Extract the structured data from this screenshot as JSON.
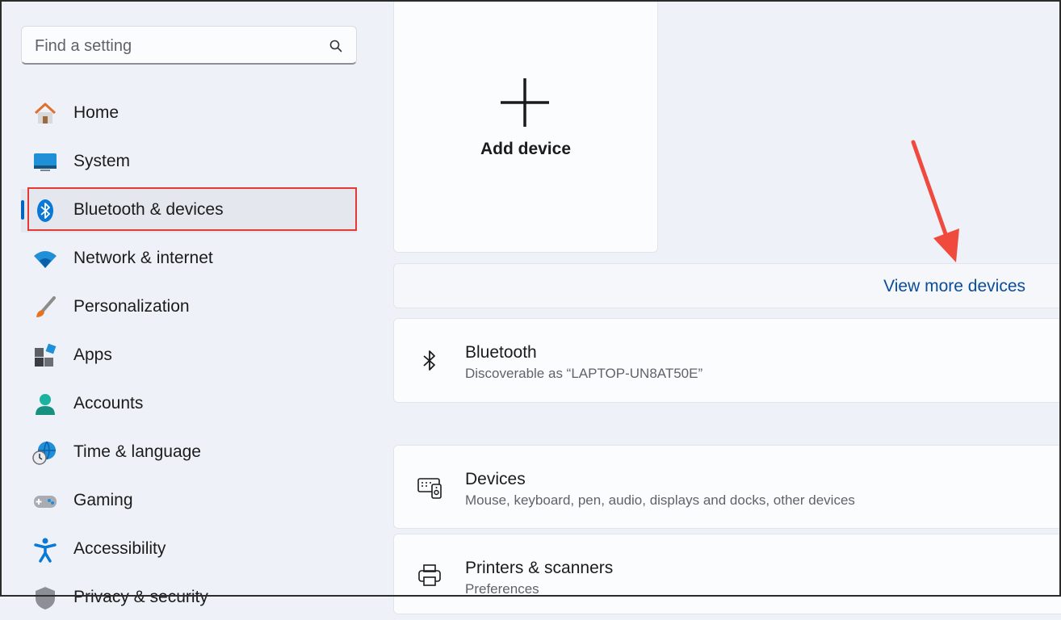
{
  "search": {
    "placeholder": "Find a setting"
  },
  "sidebar": {
    "items": [
      {
        "label": "Home"
      },
      {
        "label": "System"
      },
      {
        "label": "Bluetooth & devices"
      },
      {
        "label": "Network & internet"
      },
      {
        "label": "Personalization"
      },
      {
        "label": "Apps"
      },
      {
        "label": "Accounts"
      },
      {
        "label": "Time & language"
      },
      {
        "label": "Gaming"
      },
      {
        "label": "Accessibility"
      },
      {
        "label": "Privacy & security"
      }
    ],
    "active_index": 2
  },
  "main": {
    "add_device_label": "Add device",
    "view_more_link": "View more devices",
    "bluetooth": {
      "title": "Bluetooth",
      "subtitle": "Discoverable as “LAPTOP-UN8AT50E”"
    },
    "devices": {
      "title": "Devices",
      "subtitle": "Mouse, keyboard, pen, audio, displays and docks, other devices"
    },
    "printers": {
      "title": "Printers & scanners",
      "subtitle": "Preferences"
    }
  },
  "colors": {
    "accent": "#0067c0",
    "highlight": "#e53935",
    "link": "#0a4d9b"
  }
}
